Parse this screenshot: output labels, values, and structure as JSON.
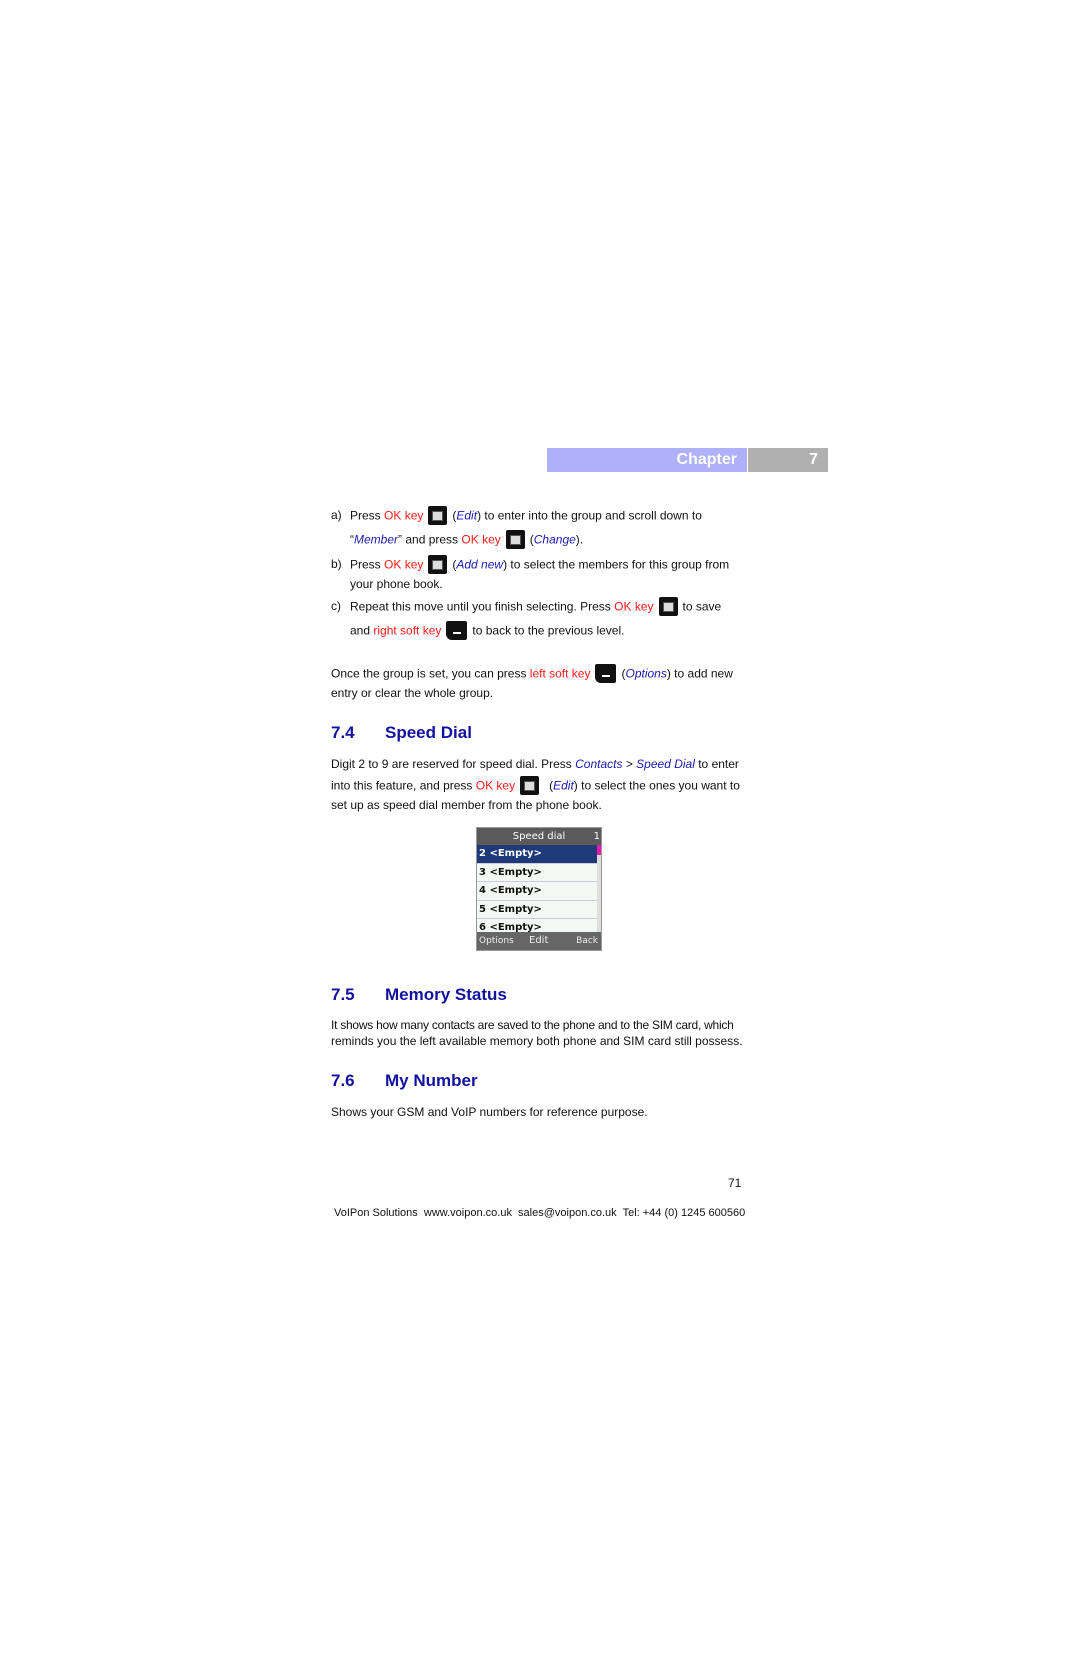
{
  "header": {
    "chapter_label": "Chapter",
    "chapter_number": "7",
    "colors": {
      "chapter_bg": "#aeb0fa",
      "number_bg": "#b0b0b0"
    }
  },
  "steps": {
    "a": {
      "marker": "a)",
      "t1": "Press ",
      "key1": "OK key",
      "t2": "(",
      "em1": "Edit",
      "t3": ") to enter into the group and scroll down to",
      "t4": "“",
      "em2": "Member",
      "t5": "” and press ",
      "key2": "OK key",
      "t6": "(",
      "em3": "Change",
      "t7": ")."
    },
    "b": {
      "marker": "b)",
      "t1": "Press ",
      "key1": "OK key",
      "t2": "(",
      "em1": "Add new",
      "t3": ") to select the members for this group from",
      "t4": "your phone book."
    },
    "c": {
      "marker": "c)",
      "t1": "Repeat this move until you finish selecting. Press ",
      "key1": "OK key",
      "t2": "to save",
      "t3": "and ",
      "key2": "right soft key",
      "t4": "to back to the previous level."
    }
  },
  "group_note": {
    "t1": "Once the group is set, you can press ",
    "key": "left soft key",
    "t2": "(",
    "em": "Options",
    "t3": ") to add new",
    "t4": "entry or clear the whole group."
  },
  "sections": [
    {
      "number": "7.4",
      "title": "Speed Dial"
    },
    {
      "number": "7.5",
      "title": "Memory Status",
      "body1": "It shows how many contacts are saved to the phone and to the SIM card, which",
      "body2": "reminds you the left available memory both phone and SIM card still possess."
    },
    {
      "number": "7.6",
      "title": "My Number",
      "body1": "Shows your GSM and VoIP numbers for reference purpose."
    }
  ],
  "speed_dial": {
    "t1": "Digit 2 to 9 are reserved for speed dial. Press ",
    "em1": "Contacts",
    "t2": " > ",
    "em2": "Speed Dial",
    "t3": " to enter",
    "t4": "into this feature, and press ",
    "key": "OK key",
    "t5": "(",
    "em3": "Edit",
    "t6": ") to select the ones you want to",
    "t7": "set up as speed dial member from the phone book."
  },
  "phone_screen": {
    "title": "Speed dial",
    "page": "1",
    "rows": [
      "2 <Empty>",
      "3 <Empty>",
      "4 <Empty>",
      "5 <Empty>",
      "6 <Empty>"
    ],
    "selected_index": 0,
    "softkeys": {
      "left": "Options",
      "center": "Edit",
      "right": "Back"
    }
  },
  "footer": {
    "page_number": "71",
    "text": "VoIPon Solutions  www.voipon.co.uk  sales@voipon.co.uk  Tel: +44 (0) 1245 600560"
  }
}
